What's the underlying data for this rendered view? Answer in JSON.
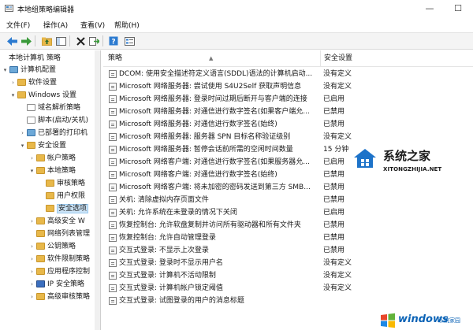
{
  "window": {
    "title": "本地组策略编辑器",
    "minimize": "—",
    "maximize": "☐"
  },
  "menu": {
    "items": [
      "文件(F)",
      "操作(A)",
      "查看(V)",
      "帮助(H)"
    ]
  },
  "toolbar": {
    "icons": [
      "back-arrow-icon",
      "forward-arrow-icon",
      "folder-up-icon",
      "show-hide-tree-icon",
      "delete-icon",
      "export-icon",
      "help-icon",
      "properties-icon"
    ]
  },
  "tree": {
    "items": [
      {
        "label": "本地计算机 策略",
        "indent": 0,
        "exp": ""
      },
      {
        "label": "计算机配置",
        "indent": 1,
        "exp": "▾"
      },
      {
        "label": "软件设置",
        "indent": 2,
        "exp": "›"
      },
      {
        "label": "Windows 设置",
        "indent": 2,
        "exp": "▾"
      },
      {
        "label": "域名解析策略",
        "indent": 3,
        "exp": ""
      },
      {
        "label": "脚本(启动/关机)",
        "indent": 3,
        "exp": ""
      },
      {
        "label": "已部署的打印机",
        "indent": 3,
        "exp": "›"
      },
      {
        "label": "安全设置",
        "indent": 3,
        "exp": "▾"
      },
      {
        "label": "帐户策略",
        "indent": 4,
        "exp": "›"
      },
      {
        "label": "本地策略",
        "indent": 4,
        "exp": "▾"
      },
      {
        "label": "审核策略",
        "indent": 5,
        "exp": ""
      },
      {
        "label": "用户权限",
        "indent": 5,
        "exp": ""
      },
      {
        "label": "安全选项",
        "indent": 5,
        "exp": ""
      },
      {
        "label": "高级安全 W",
        "indent": 4,
        "exp": "›"
      },
      {
        "label": "网络列表管理",
        "indent": 4,
        "exp": ""
      },
      {
        "label": "公钥策略",
        "indent": 4,
        "exp": "›"
      },
      {
        "label": "软件限制策略",
        "indent": 4,
        "exp": "›"
      },
      {
        "label": "应用程序控制",
        "indent": 4,
        "exp": "›"
      },
      {
        "label": "IP 安全策略",
        "indent": 4,
        "exp": "›"
      },
      {
        "label": "高级审核策略",
        "indent": 4,
        "exp": "›"
      }
    ]
  },
  "list": {
    "headers": {
      "policy": "策略",
      "setting": "安全设置"
    },
    "rows": [
      {
        "policy": "DCOM: 使用安全描述符定义语言(SDDL)语法的计算机启动...",
        "setting": "没有定义"
      },
      {
        "policy": "Microsoft 网络服务器: 尝试使用 S4U2Self 获取声明信息",
        "setting": "没有定义"
      },
      {
        "policy": "Microsoft 网络服务器: 登录时间过期后断开与客户端的连接",
        "setting": "已启用"
      },
      {
        "policy": "Microsoft 网络服务器: 对通信进行数字签名(如果客户端允...",
        "setting": "已禁用"
      },
      {
        "policy": "Microsoft 网络服务器: 对通信进行数字签名(始终)",
        "setting": "已禁用"
      },
      {
        "policy": "Microsoft 网络服务器: 服务器 SPN 目标名称验证级别",
        "setting": "没有定义"
      },
      {
        "policy": "Microsoft 网络服务器: 暂停会话前所需的空闲时间数量",
        "setting": "15 分钟"
      },
      {
        "policy": "Microsoft 网络客户端: 对通信进行数字签名(如果服务器允...",
        "setting": "已启用"
      },
      {
        "policy": "Microsoft 网络客户端: 对通信进行数字签名(始终)",
        "setting": "已禁用"
      },
      {
        "policy": "Microsoft 网络客户端: 将未加密的密码发送到第三方 SMB...",
        "setting": "已禁用"
      },
      {
        "policy": "关机: 清除虚拟内存页面文件",
        "setting": "已禁用"
      },
      {
        "policy": "关机: 允许系统在未登录的情况下关闭",
        "setting": "已启用"
      },
      {
        "policy": "恢复控制台: 允许软盘复制并访问所有驱动器和所有文件夹",
        "setting": "已禁用"
      },
      {
        "policy": "恢复控制台: 允许自动管理登录",
        "setting": "已禁用"
      },
      {
        "policy": "交互式登录: 不显示上次登录",
        "setting": "已禁用"
      },
      {
        "policy": "交互式登录: 登录时不显示用户名",
        "setting": "没有定义"
      },
      {
        "policy": "交互式登录: 计算机不活动限制",
        "setting": "没有定义"
      },
      {
        "policy": "交互式登录: 计算机帐户锁定阈值",
        "setting": "没有定义"
      },
      {
        "policy": "交互式登录: 试图登录的用户的消息标题",
        "setting": ""
      }
    ]
  },
  "watermark": {
    "title": "系统之家",
    "url": "XITONGZHIJIA.NET"
  },
  "watermark2": {
    "text": "windows",
    "sub": "系统家园"
  },
  "colors": {
    "folder": "#e8b84a",
    "selection": "#cce4f7",
    "toolbar_bg": "#f4f4f4",
    "watermark_blue": "#0b63b6"
  }
}
